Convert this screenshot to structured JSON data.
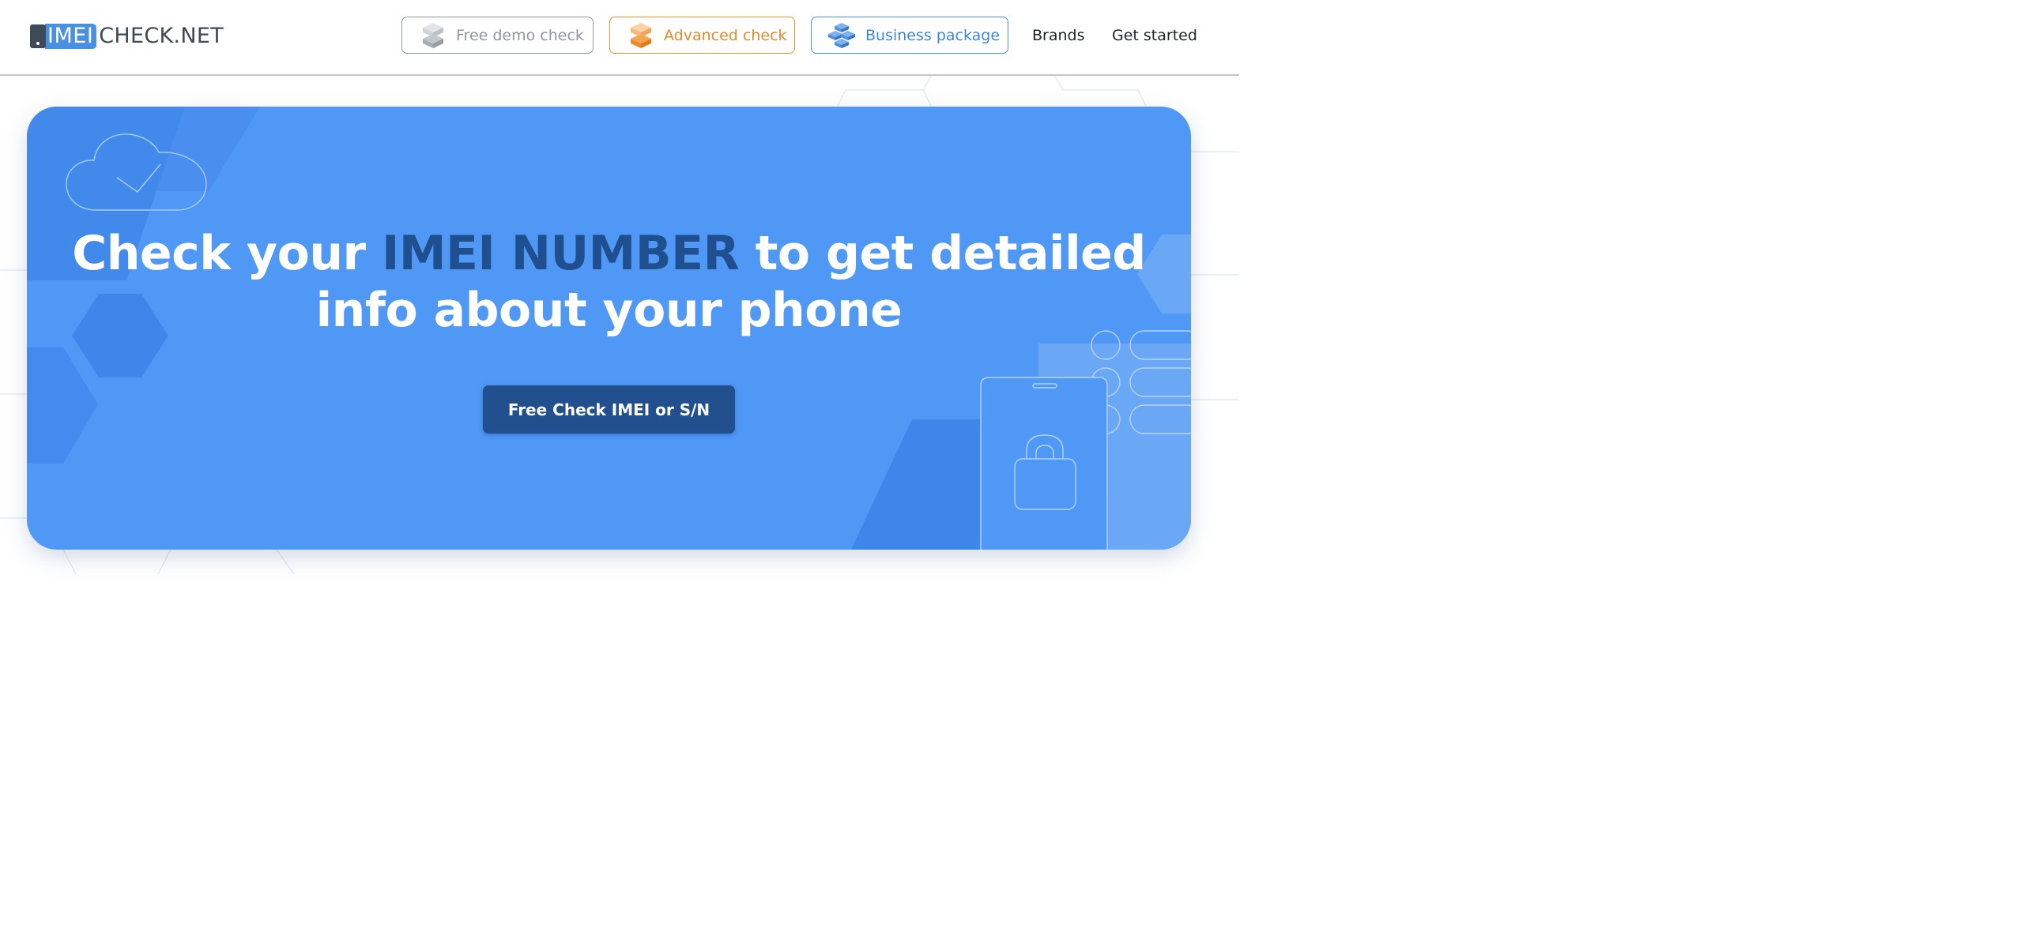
{
  "logo": {
    "imei": "IMEI",
    "rest": "CHECK.NET"
  },
  "nav": {
    "demo_label": "Free demo check",
    "advanced_label": "Advanced check",
    "business_label": "Business package",
    "brands_label": "Brands",
    "get_started_label": "Get started"
  },
  "hero": {
    "title_part1": "Check your ",
    "title_highlight": "IMEI NUMBER",
    "title_part2": " to get detailed",
    "title_line2": "info about your phone",
    "cta_label": "Free Check IMEI or S/N"
  },
  "colors": {
    "brand_blue": "#4a90e2",
    "hero_background": "#4f98f6",
    "highlight_dark_blue": "#1f4f8f",
    "cta_background": "#22508f",
    "advanced_orange": "#e9953a",
    "demo_gray": "#8e969f"
  },
  "icons": {
    "demo": "gray-stacked-cubes-icon",
    "advanced": "orange-stacked-cubes-icon",
    "business": "blue-cube-cluster-icon",
    "hero_cloud": "cloud-check-icon",
    "hero_phone": "locked-phone-icon"
  }
}
